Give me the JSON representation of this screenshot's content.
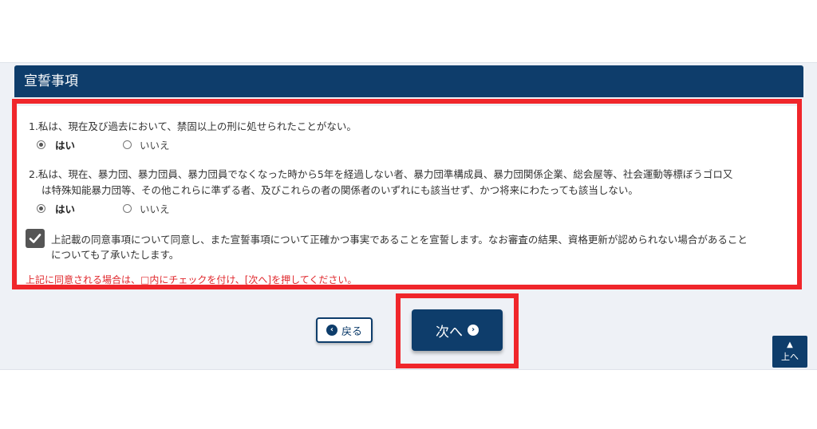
{
  "section": {
    "title": "宣誓事項"
  },
  "questions": [
    {
      "lines": [
        "1.私は、現在及び過去において、禁固以上の刑に処せられたことがない。"
      ],
      "options": [
        "はい",
        "いいえ"
      ],
      "selected": "はい"
    },
    {
      "lines": [
        "2.私は、現在、暴力団、暴力団員、暴力団員でなくなった時から5年を経過しない者、暴力団準構成員、暴力団関係企業、総会屋等、社会運動等標ぼうゴロ又",
        "は特殊知能暴力団等、その他これらに準ずる者、及びこれらの者の関係者のいずれにも該当せず、かつ将来にわたっても該当しない。"
      ],
      "options": [
        "はい",
        "いいえ"
      ],
      "selected": "はい"
    }
  ],
  "agreement": {
    "checked": true,
    "lines": [
      "上記載の同意事項について同意し、また宣誓事項について正確かつ事実であることを宣誓します。なお審査の結果、資格更新が認められない場合があること",
      "についても了承いたします。"
    ]
  },
  "note": "上記に同意される場合は、□内にチェックを付け、[次へ]を押してください。",
  "buttons": {
    "back": "戻る",
    "next": "次へ",
    "to_top": "上へ"
  },
  "colors": {
    "primary": "#0e3d6b",
    "highlight_red": "#f0262b",
    "note_red": "#e0282d"
  }
}
